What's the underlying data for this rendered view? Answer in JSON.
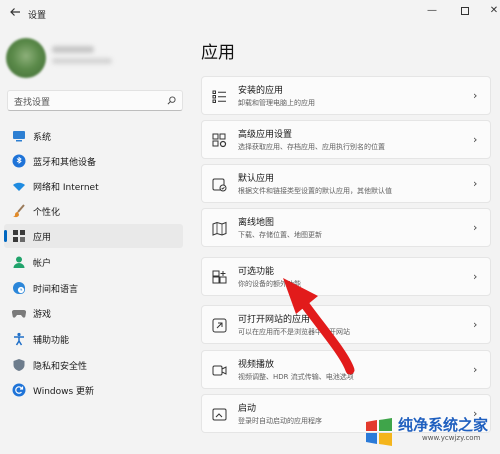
{
  "window": {
    "title": "设置",
    "back_icon": "arrow-left-icon",
    "min_label": "—",
    "close_label": "✕"
  },
  "search": {
    "placeholder": "查找设置"
  },
  "sidebar": {
    "items": [
      {
        "label": "系统",
        "icon": "monitor-icon",
        "active": false
      },
      {
        "label": "蓝牙和其他设备",
        "icon": "bluetooth-icon",
        "active": false
      },
      {
        "label": "网络和 Internet",
        "icon": "wifi-icon",
        "active": false
      },
      {
        "label": "个性化",
        "icon": "brush-icon",
        "active": false
      },
      {
        "label": "应用",
        "icon": "apps-icon",
        "active": true
      },
      {
        "label": "帐户",
        "icon": "person-icon",
        "active": false
      },
      {
        "label": "时间和语言",
        "icon": "globe-clock-icon",
        "active": false
      },
      {
        "label": "游戏",
        "icon": "gamepad-icon",
        "active": false
      },
      {
        "label": "辅助功能",
        "icon": "accessibility-icon",
        "active": false
      },
      {
        "label": "隐私和安全性",
        "icon": "shield-icon",
        "active": false
      },
      {
        "label": "Windows 更新",
        "icon": "update-icon",
        "active": false
      }
    ]
  },
  "main": {
    "title": "应用",
    "cards": [
      {
        "title": "安装的应用",
        "desc": "卸载和管理电脑上的应用",
        "icon": "list-icon"
      },
      {
        "title": "高级应用设置",
        "desc": "选择获取应用、存档应用、应用执行别名的位置",
        "icon": "app-settings-icon"
      },
      {
        "title": "默认应用",
        "desc": "根据文件和链接类型设置的默认应用，其他默认值",
        "icon": "default-app-icon"
      },
      {
        "title": "离线地图",
        "desc": "下载、存储位置、地图更新",
        "icon": "map-icon"
      },
      {
        "title": "可选功能",
        "desc": "你的设备的额外功能",
        "icon": "optional-features-icon"
      },
      {
        "title": "可打开网站的应用",
        "desc": "可以在应用而不是浏览器中打开网站",
        "icon": "web-app-icon"
      },
      {
        "title": "视频播放",
        "desc": "视频调整、HDR 流式传输、电池选项",
        "icon": "video-icon"
      },
      {
        "title": "启动",
        "desc": "登录时自动启动的应用程序",
        "icon": "startup-icon"
      }
    ]
  },
  "watermark": {
    "title": "纯净系统之家",
    "url": "www.ycwjzy.com"
  },
  "colors": {
    "accent": "#0067c0",
    "arrow": "#e21b1b"
  }
}
